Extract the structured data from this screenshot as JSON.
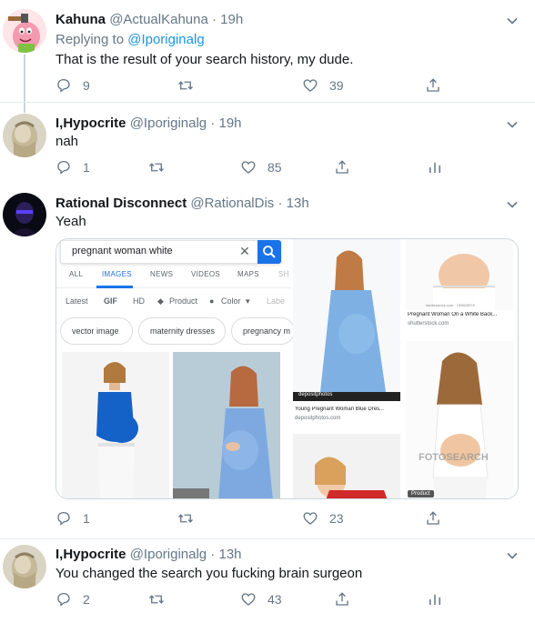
{
  "tweets": [
    {
      "name": "Kahuna",
      "handle": "@ActualKahuna",
      "dot": "·",
      "time": "19h",
      "replying_prefix": "Replying to",
      "replying_handle": "@Iporiginalg",
      "text": "That is the result of your search history, my dude.",
      "replies": "9",
      "likes": "39"
    },
    {
      "name": "I,Hypocrite",
      "handle": "@Iporiginalg",
      "dot": "·",
      "time": "19h",
      "text": "nah",
      "replies": "1",
      "likes": "85"
    },
    {
      "name": "Rational Disconnect",
      "handle": "@RationalDis",
      "dot": "·",
      "time": "13h",
      "text": "Yeah",
      "replies": "1",
      "likes": "23"
    },
    {
      "name": "I,Hypocrite",
      "handle": "@Iporiginalg",
      "dot": "·",
      "time": "13h",
      "text": "You changed the search you fucking brain surgeon",
      "replies": "2",
      "likes": "43"
    }
  ],
  "media": {
    "search_query": "pregnant woman white",
    "tabs": [
      "ALL",
      "IMAGES",
      "NEWS",
      "VIDEOS",
      "MAPS",
      "SH"
    ],
    "tools": [
      "Latest",
      "GIF",
      "HD",
      "Product",
      "Color",
      "Labe"
    ],
    "chips": [
      "vector image",
      "maternity dresses",
      "pregnancy m"
    ],
    "caption_1": "Pregnant Woman On a White Back...",
    "source_1": "shutterstock.com",
    "caption_2": "Young Pregnant Woman Blue Dres...",
    "source_2": "depositphotos.com",
    "watermark_1": "depositphotos",
    "watermark_2": "FOTOSEARCH",
    "badge": "Product",
    "small_watermark": "shutterstock.com · 159625979"
  },
  "colors": {
    "link": "#1b95e0",
    "secondary_text": "#657786",
    "google_blue": "#1a73e8"
  },
  "icons": [
    "reply-icon",
    "retweet-icon",
    "like-icon",
    "share-icon",
    "analytics-icon",
    "chevron-down-icon",
    "search-icon",
    "close-icon"
  ]
}
